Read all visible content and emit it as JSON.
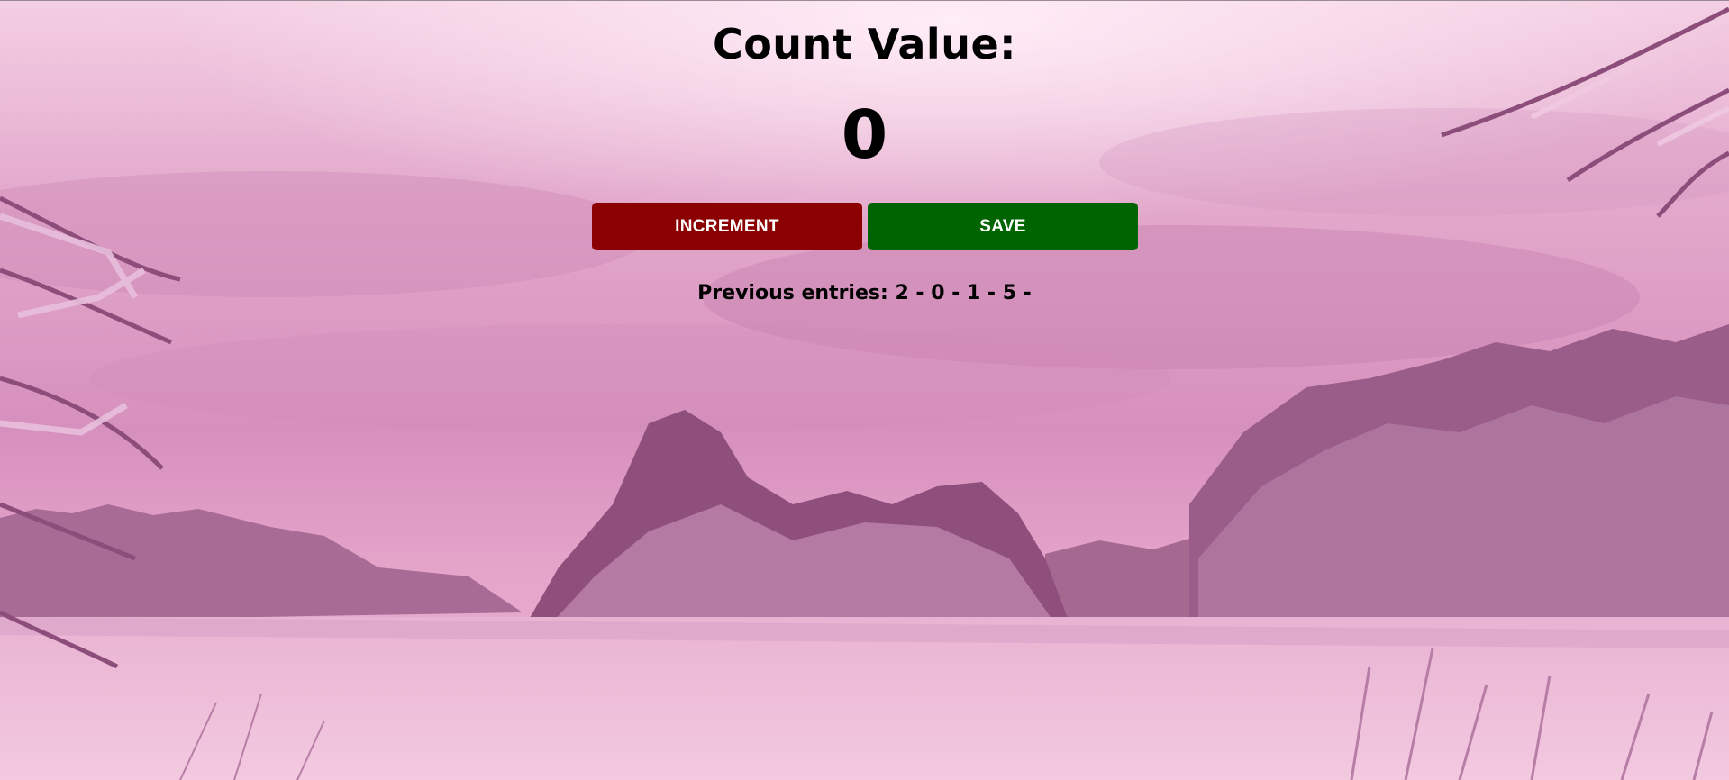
{
  "heading": "Count Value:",
  "count": "0",
  "buttons": {
    "increment_label": "INCREMENT",
    "save_label": "SAVE"
  },
  "entries_text": "Previous entries: 2 - 0 - 1 - 5 -",
  "colors": {
    "increment_bg": "#8b0000",
    "save_bg": "#006400",
    "background_tint": "#c98cb4"
  }
}
